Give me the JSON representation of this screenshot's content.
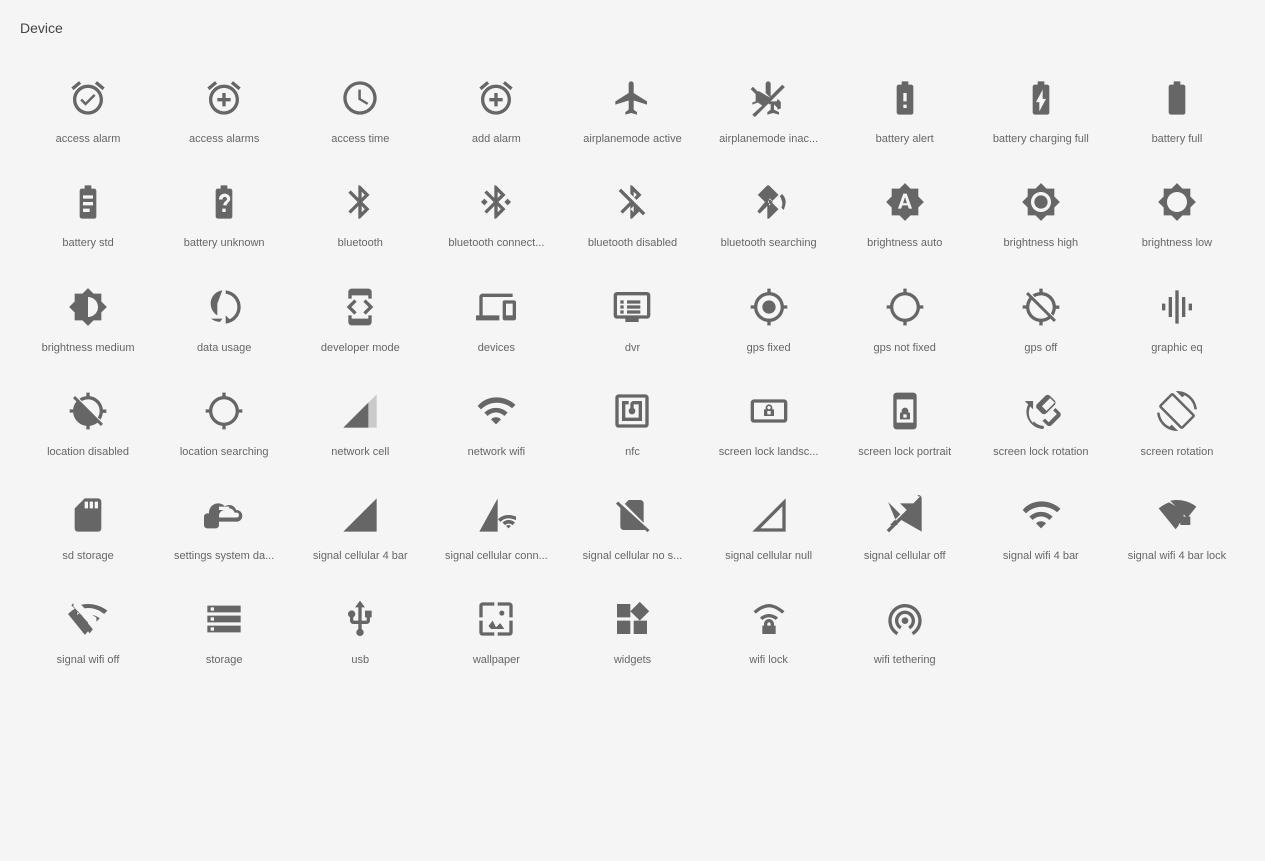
{
  "page": {
    "title": "Device"
  },
  "icons": [
    {
      "name": "access-alarm",
      "label": "access alarm"
    },
    {
      "name": "access-alarms",
      "label": "access alarms"
    },
    {
      "name": "access-time",
      "label": "access time"
    },
    {
      "name": "add-alarm",
      "label": "add alarm"
    },
    {
      "name": "airplanemode-active",
      "label": "airplanemode active"
    },
    {
      "name": "airplanemode-inactive",
      "label": "airplanemode inac..."
    },
    {
      "name": "battery-alert",
      "label": "battery alert"
    },
    {
      "name": "battery-charging-full",
      "label": "battery charging full"
    },
    {
      "name": "battery-full",
      "label": "battery full"
    },
    {
      "name": "battery-std",
      "label": "battery std"
    },
    {
      "name": "battery-unknown",
      "label": "battery unknown"
    },
    {
      "name": "bluetooth",
      "label": "bluetooth"
    },
    {
      "name": "bluetooth-connected",
      "label": "bluetooth connect..."
    },
    {
      "name": "bluetooth-disabled",
      "label": "bluetooth disabled"
    },
    {
      "name": "bluetooth-searching",
      "label": "bluetooth searching"
    },
    {
      "name": "brightness-auto",
      "label": "brightness auto"
    },
    {
      "name": "brightness-high",
      "label": "brightness high"
    },
    {
      "name": "brightness-low",
      "label": "brightness low"
    },
    {
      "name": "brightness-medium",
      "label": "brightness medium"
    },
    {
      "name": "data-usage",
      "label": "data usage"
    },
    {
      "name": "developer-mode",
      "label": "developer mode"
    },
    {
      "name": "devices",
      "label": "devices"
    },
    {
      "name": "dvr",
      "label": "dvr"
    },
    {
      "name": "gps-fixed",
      "label": "gps fixed"
    },
    {
      "name": "gps-not-fixed",
      "label": "gps not fixed"
    },
    {
      "name": "gps-off",
      "label": "gps off"
    },
    {
      "name": "graphic-eq",
      "label": "graphic eq"
    },
    {
      "name": "location-disabled",
      "label": "location disabled"
    },
    {
      "name": "location-searching",
      "label": "location searching"
    },
    {
      "name": "network-cell",
      "label": "network cell"
    },
    {
      "name": "network-wifi",
      "label": "network wifi"
    },
    {
      "name": "nfc",
      "label": "nfc"
    },
    {
      "name": "screen-lock-landscape",
      "label": "screen lock landsc..."
    },
    {
      "name": "screen-lock-portrait",
      "label": "screen lock portrait"
    },
    {
      "name": "screen-lock-rotation",
      "label": "screen lock rotation"
    },
    {
      "name": "screen-rotation",
      "label": "screen rotation"
    },
    {
      "name": "sd-storage",
      "label": "sd storage"
    },
    {
      "name": "settings-system-daydream",
      "label": "settings system da..."
    },
    {
      "name": "signal-cellular-4-bar",
      "label": "signal cellular 4 bar"
    },
    {
      "name": "signal-cellular-connected",
      "label": "signal cellular conn..."
    },
    {
      "name": "signal-cellular-no-sim",
      "label": "signal cellular no s..."
    },
    {
      "name": "signal-cellular-null",
      "label": "signal cellular null"
    },
    {
      "name": "signal-cellular-off",
      "label": "signal cellular off"
    },
    {
      "name": "signal-wifi-4-bar",
      "label": "signal wifi 4 bar"
    },
    {
      "name": "signal-wifi-4-bar-lock",
      "label": "signal wifi 4 bar lock"
    },
    {
      "name": "signal-wifi-off",
      "label": "signal wifi off"
    },
    {
      "name": "storage",
      "label": "storage"
    },
    {
      "name": "usb",
      "label": "usb"
    },
    {
      "name": "wallpaper",
      "label": "wallpaper"
    },
    {
      "name": "widgets",
      "label": "widgets"
    },
    {
      "name": "wifi-lock",
      "label": "wifi lock"
    },
    {
      "name": "wifi-tethering",
      "label": "wifi tethering"
    }
  ]
}
